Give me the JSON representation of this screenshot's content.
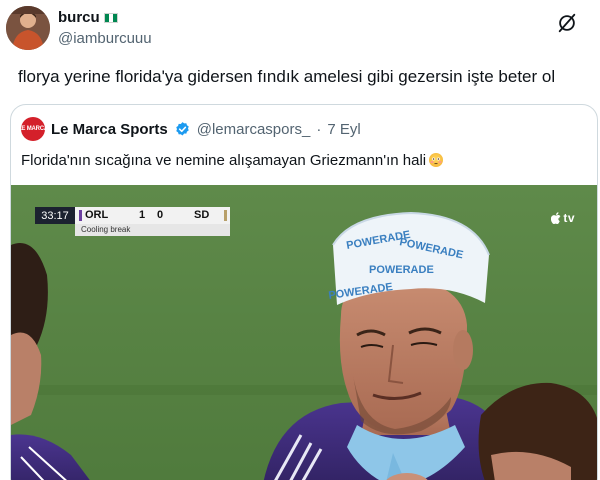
{
  "tweet": {
    "display_name": "burcu",
    "handle": "@iamburcuuu",
    "text": "florya yerine florida'ya gidersen fındık amelesi gibi gezersin işte beter ol"
  },
  "quote": {
    "avatar_text": "LE MARCA",
    "display_name": "Le Marca Sports",
    "handle": "@lemarcaspors_",
    "separator": "·",
    "time": "7 Eyl",
    "text": "Florida'nın sıcağına ve nemine alışamayan Griezmann'ın hali",
    "video": {
      "clock": "33:17",
      "home_team": "ORL",
      "home_score": "1",
      "away_score": "0",
      "away_team": "SD",
      "status": "Cooling break",
      "broadcaster": "tv",
      "home_color": "#6b3fa0",
      "away_color": "#b8a06a",
      "headband_text": "POWERADE"
    }
  },
  "icons": {
    "grok": "grok-icon",
    "verified": "verified-badge-icon",
    "apple": "apple-icon"
  }
}
